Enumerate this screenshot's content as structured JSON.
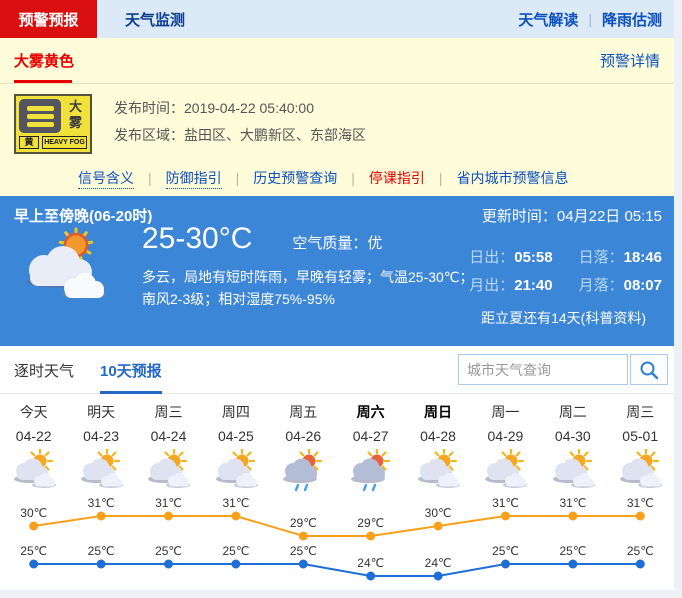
{
  "topnav": {
    "active_tab": "预警预报",
    "inactive_tab": "天气监测",
    "links": [
      {
        "label": "天气解读"
      },
      {
        "label": "降雨估测"
      }
    ]
  },
  "warning": {
    "tab_label": "大雾黄色",
    "detail_link": "预警详情",
    "icon": {
      "name": "大雾",
      "level": "黄",
      "en": "HEAVY FOG"
    },
    "publish_time_label": "发布时间：",
    "publish_time_value": "2019-04-22 05:40:00",
    "publish_area_label": "发布区域：",
    "publish_area_value": "盐田区、大鹏新区、东部海区",
    "links": [
      {
        "label": "信号含义"
      },
      {
        "label": "防御指引"
      },
      {
        "label": "历史预警查询"
      },
      {
        "label": "停课指引"
      },
      {
        "label": "省内城市预警信息"
      }
    ]
  },
  "current": {
    "period": "早上至傍晚(06-20时)",
    "update_label": "更新时间：",
    "update_value": "04月22日 05:15",
    "temp_range": "25-30°C",
    "air_label": "空气质量：",
    "air_value": "优",
    "desc_line1": "多云，局地有短时阵雨，早晚有轻雾；气温25-30℃；",
    "desc_line2": "南风2-3级；相对湿度75%-95%",
    "sun_moon": [
      {
        "label": "日出：",
        "value": "05:58"
      },
      {
        "label": "日落：",
        "value": "18:46"
      },
      {
        "label": "月出：",
        "value": "21:40"
      },
      {
        "label": "月落：",
        "value": "08:07"
      }
    ],
    "solar_term": "距立夏还有14天(科普资料)"
  },
  "forecast_tabs": {
    "hourly": "逐时天气",
    "ten_day": "10天预报"
  },
  "search": {
    "placeholder": "城市天气查询"
  },
  "chart_data": {
    "type": "line",
    "title": "10天预报",
    "categories": [
      "今天",
      "明天",
      "周三",
      "周四",
      "周五",
      "周六",
      "周日",
      "周一",
      "周二",
      "周三"
    ],
    "dates": [
      "04-22",
      "04-23",
      "04-24",
      "04-25",
      "04-26",
      "04-27",
      "04-28",
      "04-29",
      "04-30",
      "05-01"
    ],
    "icons": [
      "partly-cloudy",
      "partly-cloudy",
      "partly-cloudy",
      "partly-cloudy",
      "showers",
      "showers",
      "partly-cloudy",
      "partly-cloudy",
      "partly-cloudy",
      "partly-cloudy"
    ],
    "bold_days": [
      5,
      6
    ],
    "series": [
      {
        "name": "high",
        "unit": "℃",
        "color": "#f9a01b",
        "values": [
          30,
          31,
          31,
          31,
          29,
          29,
          30,
          31,
          31,
          31
        ]
      },
      {
        "name": "low",
        "unit": "℃",
        "color": "#1e6ed6",
        "values": [
          25,
          25,
          25,
          25,
          25,
          24,
          24,
          25,
          25,
          25
        ]
      }
    ],
    "ylim": [
      24,
      31
    ],
    "legend_position": "none",
    "grid": false
  },
  "colors": {
    "accent_red": "#d9100f",
    "warning_red": "#e60000",
    "link_blue": "#0b50c0",
    "panel_blue": "#3c86d8",
    "high_line": "#f9a01b",
    "low_line": "#1e6ed6"
  }
}
